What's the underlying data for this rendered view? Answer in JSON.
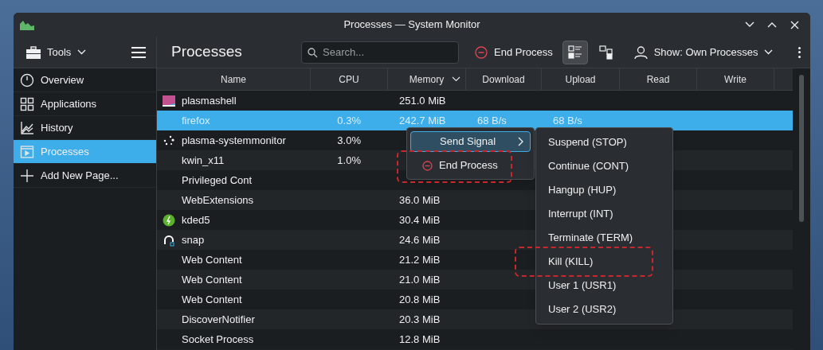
{
  "window": {
    "title": "Processes — System Monitor"
  },
  "sidebar": {
    "tools_label": "Tools",
    "items": [
      {
        "label": "Overview",
        "kind": "overview",
        "selected": false
      },
      {
        "label": "Applications",
        "kind": "apps",
        "selected": false
      },
      {
        "label": "History",
        "kind": "history",
        "selected": false
      },
      {
        "label": "Processes",
        "kind": "processes",
        "selected": true
      },
      {
        "label": "Add New Page...",
        "kind": "add",
        "selected": false
      }
    ]
  },
  "toolbar": {
    "page_title": "Processes",
    "search": {
      "placeholder": "Search..."
    },
    "end_process": "End Process",
    "show_filter": "Show: Own Processes"
  },
  "table": {
    "columns": [
      {
        "label": "Name",
        "sorted": false
      },
      {
        "label": "CPU",
        "sorted": false
      },
      {
        "label": "Memory",
        "sorted": true
      },
      {
        "label": "Download",
        "sorted": false
      },
      {
        "label": "Upload",
        "sorted": false
      },
      {
        "label": "Read",
        "sorted": false
      },
      {
        "label": "Write",
        "sorted": false
      }
    ],
    "rows": [
      {
        "kind": "plasma",
        "name": "plasmashell",
        "cpu": "",
        "memory": "251.0 MiB",
        "download": "",
        "upload": "",
        "selected": false
      },
      {
        "kind": "plain",
        "name": "firefox",
        "cpu": "0.3%",
        "memory": "242.7 MiB",
        "download": "68 B/s",
        "upload": "68 B/s",
        "selected": true
      },
      {
        "kind": "spinner",
        "name": "plasma-systemmonitor",
        "cpu": "3.0%",
        "memory": "",
        "download": "",
        "upload": "",
        "selected": false
      },
      {
        "kind": "plain",
        "name": "kwin_x11",
        "cpu": "1.0%",
        "memory": "",
        "download": "",
        "upload": "",
        "selected": false
      },
      {
        "kind": "plain",
        "name": "Privileged Cont",
        "cpu": "",
        "memory": "",
        "download": "",
        "upload": "",
        "selected": false
      },
      {
        "kind": "plain",
        "name": "WebExtensions",
        "cpu": "",
        "memory": "36.0 MiB",
        "download": "",
        "upload": "",
        "selected": false
      },
      {
        "kind": "kded",
        "name": "kded5",
        "cpu": "",
        "memory": "30.4 MiB",
        "download": "",
        "upload": "",
        "selected": false
      },
      {
        "kind": "snap",
        "name": "snap",
        "cpu": "",
        "memory": "24.6 MiB",
        "download": "",
        "upload": "",
        "selected": false
      },
      {
        "kind": "plain",
        "name": "Web Content",
        "cpu": "",
        "memory": "21.2 MiB",
        "download": "",
        "upload": "",
        "selected": false
      },
      {
        "kind": "plain",
        "name": "Web Content",
        "cpu": "",
        "memory": "21.0 MiB",
        "download": "",
        "upload": "",
        "selected": false
      },
      {
        "kind": "plain",
        "name": "Web Content",
        "cpu": "",
        "memory": "20.8 MiB",
        "download": "",
        "upload": "",
        "selected": false
      },
      {
        "kind": "plain",
        "name": "DiscoverNotifier",
        "cpu": "",
        "memory": "20.3 MiB",
        "download": "",
        "upload": "",
        "selected": false
      },
      {
        "kind": "plain",
        "name": "Socket Process",
        "cpu": "",
        "memory": "12.8 MiB",
        "download": "",
        "upload": "",
        "selected": false
      }
    ]
  },
  "context_menu": {
    "items": [
      {
        "label": "Send Signal",
        "kind": "submenu",
        "selected": true
      },
      {
        "label": "End Process",
        "kind": "end",
        "selected": false
      }
    ]
  },
  "signal_menu": {
    "items": [
      "Suspend (STOP)",
      "Continue (CONT)",
      "Hangup (HUP)",
      "Interrupt (INT)",
      "Terminate (TERM)",
      "Kill (KILL)",
      "User 1 (USR1)",
      "User 2 (USR2)"
    ]
  }
}
